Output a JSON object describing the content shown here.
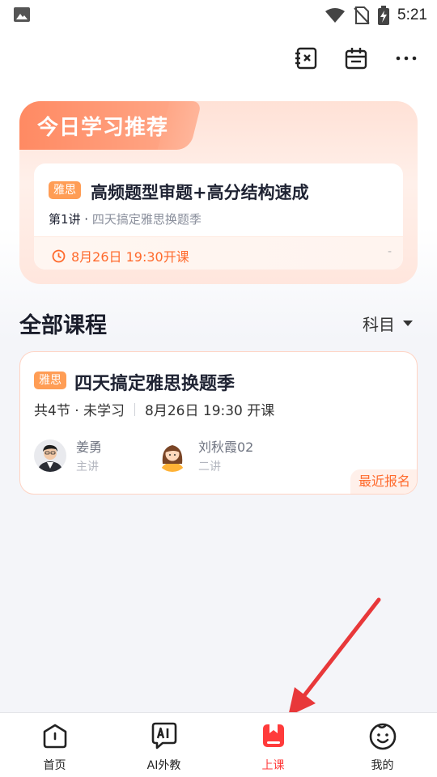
{
  "status_bar": {
    "time": "5:21",
    "left_icon": "image-icon",
    "right_icons": [
      "wifi-icon",
      "no-sim-icon",
      "battery-charging-icon"
    ]
  },
  "toolbar": {
    "icons": [
      "notebook-close-icon",
      "calendar-icon",
      "more-icon"
    ]
  },
  "recommendation": {
    "title": "今日学习推荐",
    "tag": "雅思",
    "course_title": "高频题型审题+高分结构速成",
    "lesson": "第1讲 ·",
    "lesson_course": " 四天搞定雅思换题季",
    "time": "8月26日 19:30开课",
    "trailing": "-"
  },
  "all_courses": {
    "title": "全部课程",
    "filter_label": "科目"
  },
  "course": {
    "tag": "雅思",
    "title": "四天搞定雅思换题季",
    "meta_left": "共4节 · 未学习",
    "meta_right": "8月26日 19:30 开课",
    "teachers": [
      {
        "name": "姜勇",
        "role": "主讲"
      },
      {
        "name": "刘秋霞02",
        "role": "二讲"
      }
    ],
    "badge": "最近报名"
  },
  "bottom_nav": {
    "items": [
      {
        "label": "首页",
        "icon": "home-icon"
      },
      {
        "label": "AI外教",
        "icon": "ai-tutor-icon"
      },
      {
        "label": "上课",
        "icon": "class-book-icon",
        "active": true
      },
      {
        "label": "我的",
        "icon": "profile-face-icon"
      }
    ]
  },
  "colors": {
    "accent": "#ff6a2c",
    "active_nav": "#ff3b3b",
    "tag": "#ff9d55",
    "annotation_arrow": "#e8383a"
  }
}
